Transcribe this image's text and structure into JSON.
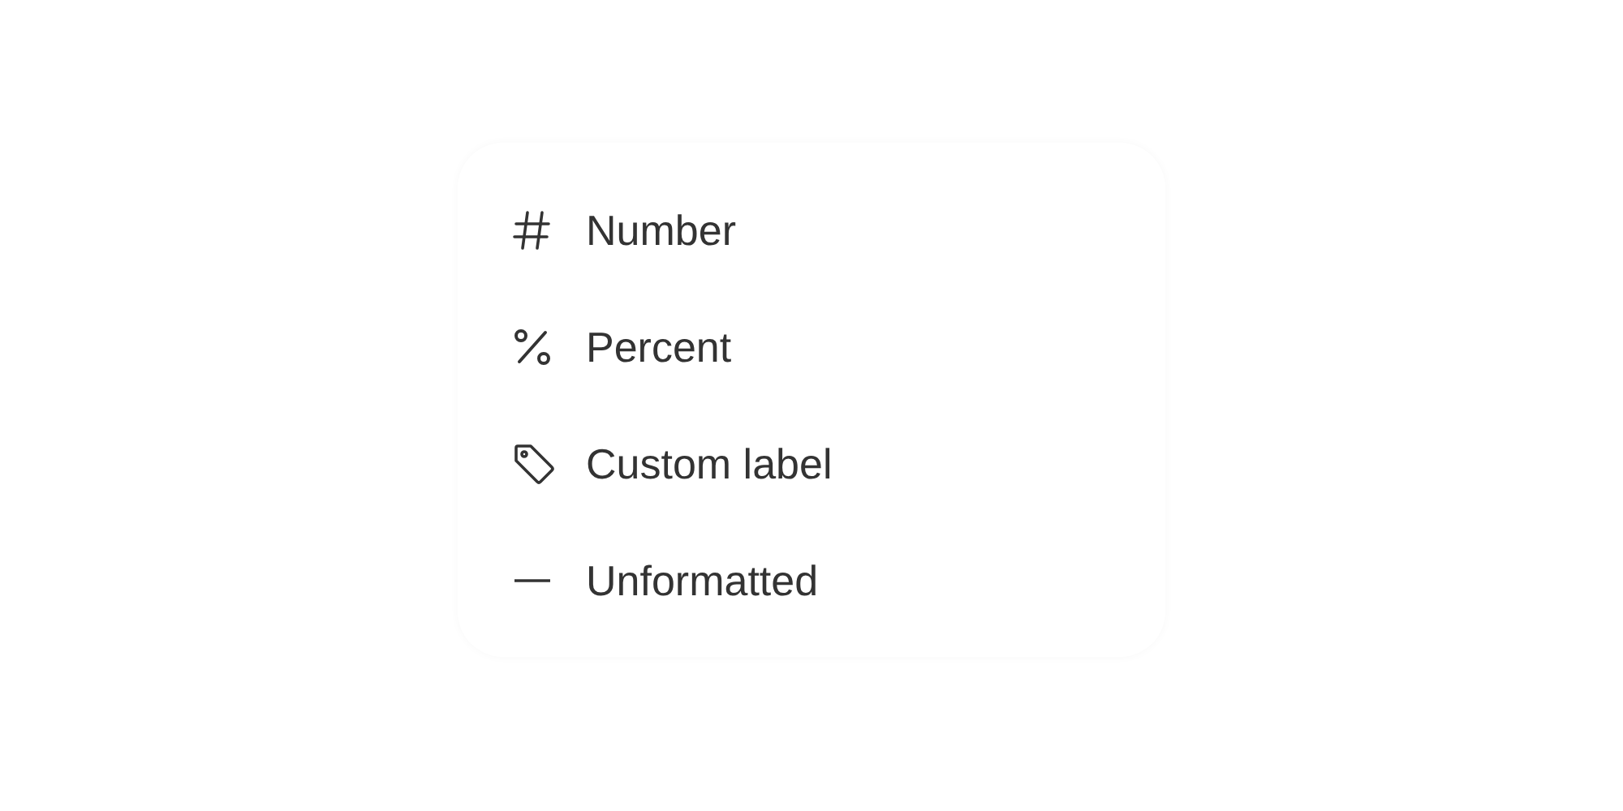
{
  "menu": {
    "items": [
      {
        "kind": "number",
        "label": "Number"
      },
      {
        "kind": "percent",
        "label": "Percent"
      },
      {
        "kind": "tag",
        "label": "Custom label"
      },
      {
        "kind": "none",
        "label": "Unformatted"
      }
    ]
  }
}
